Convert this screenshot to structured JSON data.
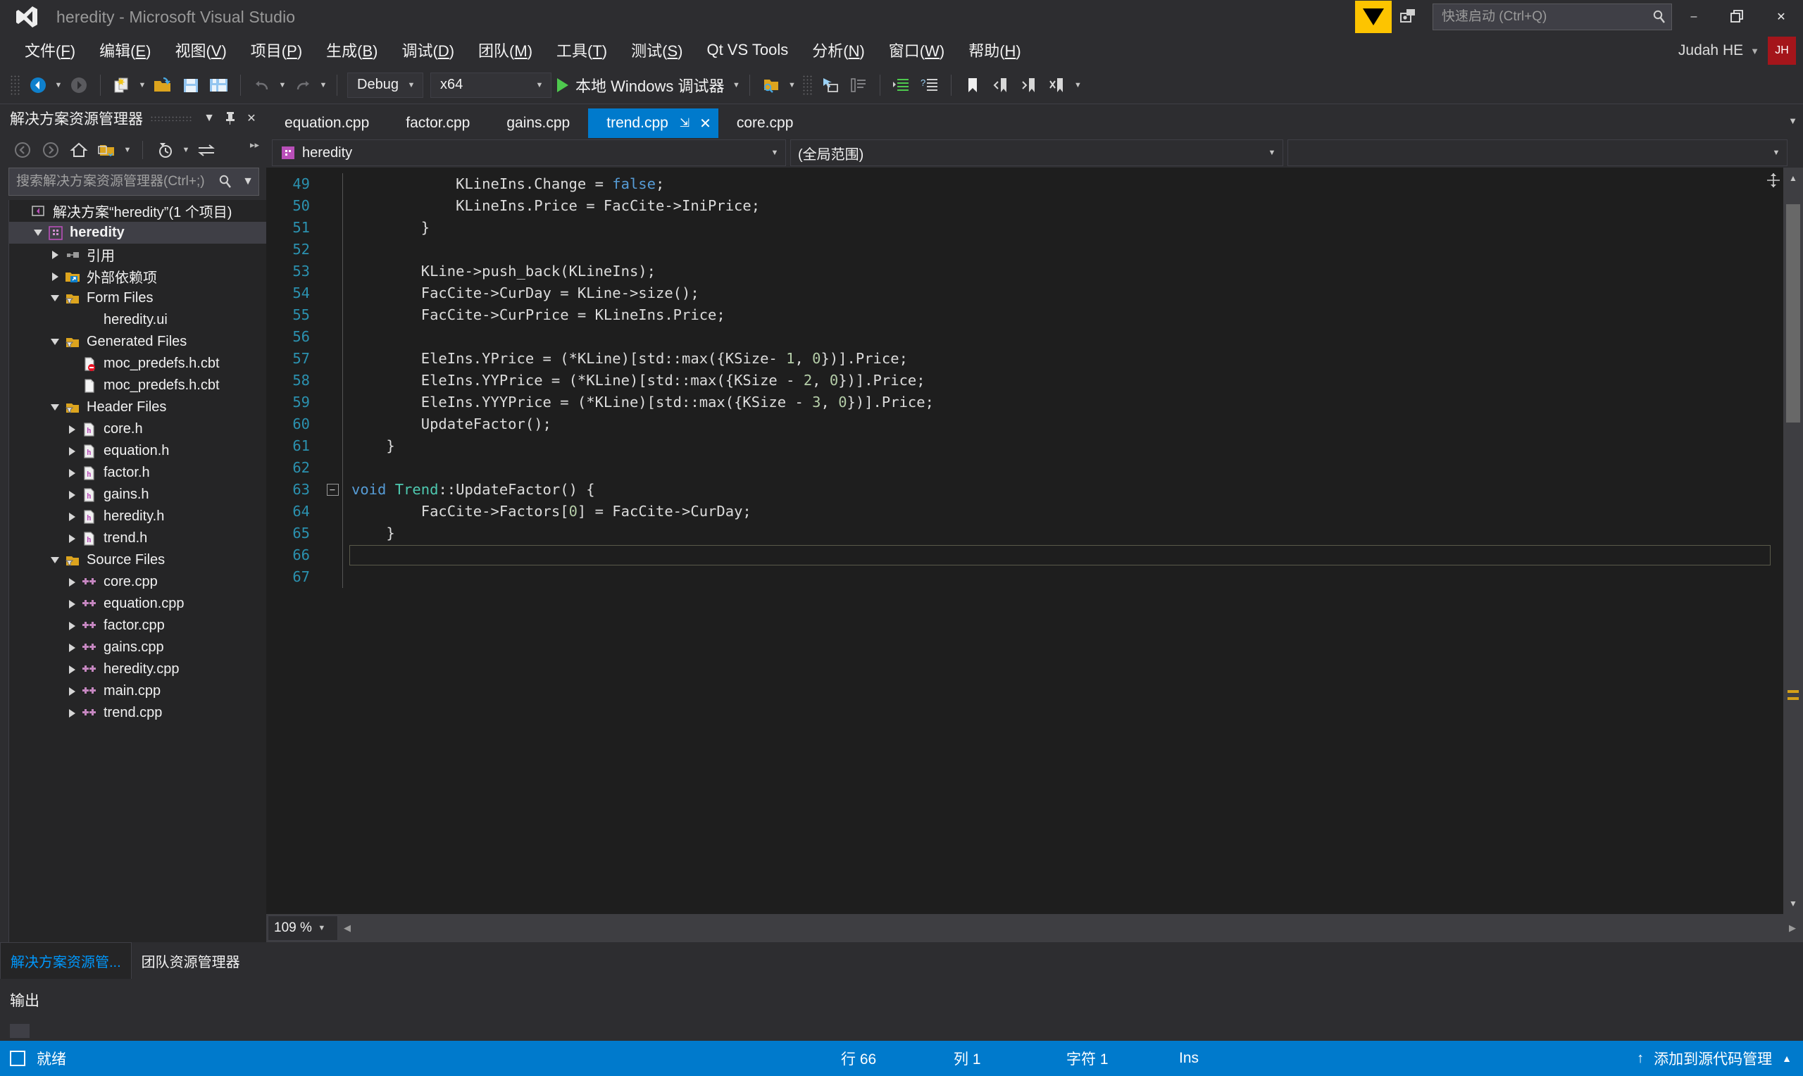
{
  "window": {
    "title": "heredity - Microsoft Visual Studio",
    "minimize": "–",
    "restore": "❐",
    "close": "✕"
  },
  "titlebar": {
    "quick_launch_placeholder": "快速启动 (Ctrl+Q)",
    "quick_launch_value": "",
    "user_name": "Judah HE",
    "user_initials": "JH",
    "accent_color": "#007acc",
    "feedback_color": "#fdc400",
    "avatar_color": "#a4151b"
  },
  "menubar": {
    "items": [
      {
        "label": "文件(F)",
        "key": "F"
      },
      {
        "label": "编辑(E)",
        "key": "E"
      },
      {
        "label": "视图(V)",
        "key": "V"
      },
      {
        "label": "项目(P)",
        "key": "P"
      },
      {
        "label": "生成(B)",
        "key": "B"
      },
      {
        "label": "调试(D)",
        "key": "D"
      },
      {
        "label": "团队(M)",
        "key": "M"
      },
      {
        "label": "工具(T)",
        "key": "T"
      },
      {
        "label": "测试(S)",
        "key": "S"
      },
      {
        "label": "Qt VS Tools",
        "key": ""
      },
      {
        "label": "分析(N)",
        "key": "N"
      },
      {
        "label": "窗口(W)",
        "key": "W"
      },
      {
        "label": "帮助(H)",
        "key": "H"
      }
    ]
  },
  "toolbar": {
    "configuration": "Debug",
    "platform": "x64",
    "run_label": "本地 Windows 调试器",
    "icons": [
      "navigate-back-icon",
      "navigate-forward-icon",
      "new-item-icon",
      "open-file-icon",
      "save-icon",
      "save-all-icon",
      "undo-icon",
      "redo-icon"
    ]
  },
  "solution_explorer": {
    "title": "解决方案资源管理器",
    "search_placeholder": "搜索解决方案资源管理器(Ctrl+;)",
    "search_value": "",
    "tree": [
      {
        "label": "解决方案“heredity”(1 个项目)",
        "indent": 0,
        "twisty": "none",
        "icon": "solution-icon",
        "bold": false,
        "selected": false
      },
      {
        "label": "heredity",
        "indent": 1,
        "twisty": "down",
        "icon": "project-icon",
        "bold": true,
        "selected": true
      },
      {
        "label": "引用",
        "indent": 2,
        "twisty": "right",
        "icon": "references-icon",
        "bold": false,
        "selected": false
      },
      {
        "label": "外部依赖项",
        "indent": 2,
        "twisty": "right",
        "icon": "extdeps-icon",
        "bold": false,
        "selected": false
      },
      {
        "label": "Form Files",
        "indent": 2,
        "twisty": "down",
        "icon": "filter-folder-icon",
        "bold": false,
        "selected": false
      },
      {
        "label": "heredity.ui",
        "indent": 3,
        "twisty": "none",
        "icon": "none",
        "bold": false,
        "selected": false
      },
      {
        "label": "Generated Files",
        "indent": 2,
        "twisty": "down",
        "icon": "filter-folder-icon",
        "bold": false,
        "selected": false
      },
      {
        "label": "moc_predefs.h.cbt",
        "indent": 3,
        "twisty": "none",
        "icon": "file-error-icon",
        "bold": false,
        "selected": false
      },
      {
        "label": "moc_predefs.h.cbt",
        "indent": 3,
        "twisty": "none",
        "icon": "file-icon",
        "bold": false,
        "selected": false
      },
      {
        "label": "Header Files",
        "indent": 2,
        "twisty": "down",
        "icon": "filter-folder-icon",
        "bold": false,
        "selected": false
      },
      {
        "label": "core.h",
        "indent": 3,
        "twisty": "right",
        "icon": "header-icon",
        "bold": false,
        "selected": false
      },
      {
        "label": "equation.h",
        "indent": 3,
        "twisty": "right",
        "icon": "header-icon",
        "bold": false,
        "selected": false
      },
      {
        "label": "factor.h",
        "indent": 3,
        "twisty": "right",
        "icon": "header-icon",
        "bold": false,
        "selected": false
      },
      {
        "label": "gains.h",
        "indent": 3,
        "twisty": "right",
        "icon": "header-icon",
        "bold": false,
        "selected": false
      },
      {
        "label": "heredity.h",
        "indent": 3,
        "twisty": "right",
        "icon": "header-icon",
        "bold": false,
        "selected": false
      },
      {
        "label": "trend.h",
        "indent": 3,
        "twisty": "right",
        "icon": "header-icon",
        "bold": false,
        "selected": false
      },
      {
        "label": "Source Files",
        "indent": 2,
        "twisty": "down",
        "icon": "filter-folder-icon",
        "bold": false,
        "selected": false
      },
      {
        "label": "core.cpp",
        "indent": 3,
        "twisty": "right",
        "icon": "cpp-icon",
        "bold": false,
        "selected": false
      },
      {
        "label": "equation.cpp",
        "indent": 3,
        "twisty": "right",
        "icon": "cpp-icon",
        "bold": false,
        "selected": false
      },
      {
        "label": "factor.cpp",
        "indent": 3,
        "twisty": "right",
        "icon": "cpp-icon",
        "bold": false,
        "selected": false
      },
      {
        "label": "gains.cpp",
        "indent": 3,
        "twisty": "right",
        "icon": "cpp-icon",
        "bold": false,
        "selected": false
      },
      {
        "label": "heredity.cpp",
        "indent": 3,
        "twisty": "right",
        "icon": "cpp-icon",
        "bold": false,
        "selected": false
      },
      {
        "label": "main.cpp",
        "indent": 3,
        "twisty": "right",
        "icon": "cpp-icon",
        "bold": false,
        "selected": false
      },
      {
        "label": "trend.cpp",
        "indent": 3,
        "twisty": "right",
        "icon": "cpp-icon",
        "bold": false,
        "selected": false
      }
    ]
  },
  "editor": {
    "tabs": [
      {
        "label": "equation.cpp",
        "active": false
      },
      {
        "label": "factor.cpp",
        "active": false
      },
      {
        "label": "gains.cpp",
        "active": false
      },
      {
        "label": "trend.cpp",
        "active": true
      },
      {
        "label": "core.cpp",
        "active": false
      }
    ],
    "tab_pin": "⇲",
    "tab_close": "✕",
    "nav_project": "heredity",
    "nav_scope": "(全局范围)",
    "nav_member": "",
    "zoom": "109 %",
    "lines": [
      {
        "n": 49,
        "fold": "",
        "indent": 3,
        "tokens": [
          {
            "t": "KLineIns.Change = ",
            "c": ""
          },
          {
            "t": "false",
            "c": "kw"
          },
          {
            "t": ";",
            "c": ""
          }
        ]
      },
      {
        "n": 50,
        "fold": "",
        "indent": 3,
        "tokens": [
          {
            "t": "KLineIns.Price = FacCite->IniPrice;",
            "c": ""
          }
        ]
      },
      {
        "n": 51,
        "fold": "",
        "indent": 2,
        "tokens": [
          {
            "t": "}",
            "c": ""
          }
        ]
      },
      {
        "n": 52,
        "fold": "",
        "indent": 0,
        "tokens": [
          {
            "t": "",
            "c": ""
          }
        ]
      },
      {
        "n": 53,
        "fold": "",
        "indent": 2,
        "tokens": [
          {
            "t": "KLine->push_back(KLineIns);",
            "c": ""
          }
        ]
      },
      {
        "n": 54,
        "fold": "",
        "indent": 2,
        "tokens": [
          {
            "t": "FacCite->CurDay = KLine->size();",
            "c": ""
          }
        ]
      },
      {
        "n": 55,
        "fold": "",
        "indent": 2,
        "tokens": [
          {
            "t": "FacCite->CurPrice = KLineIns.Price;",
            "c": ""
          }
        ]
      },
      {
        "n": 56,
        "fold": "",
        "indent": 0,
        "tokens": [
          {
            "t": "",
            "c": ""
          }
        ]
      },
      {
        "n": 57,
        "fold": "",
        "indent": 2,
        "tokens": [
          {
            "t": "EleIns.YPrice = (*KLine)[std::max({KSize- ",
            "c": ""
          },
          {
            "t": "1",
            "c": "num"
          },
          {
            "t": ", ",
            "c": ""
          },
          {
            "t": "0",
            "c": "num"
          },
          {
            "t": "})].Price;",
            "c": ""
          }
        ]
      },
      {
        "n": 58,
        "fold": "",
        "indent": 2,
        "tokens": [
          {
            "t": "EleIns.YYPrice = (*KLine)[std::max({KSize - ",
            "c": ""
          },
          {
            "t": "2",
            "c": "num"
          },
          {
            "t": ", ",
            "c": ""
          },
          {
            "t": "0",
            "c": "num"
          },
          {
            "t": "})].Price;",
            "c": ""
          }
        ]
      },
      {
        "n": 59,
        "fold": "",
        "indent": 2,
        "tokens": [
          {
            "t": "EleIns.YYYPrice = (*KLine)[std::max({KSize - ",
            "c": ""
          },
          {
            "t": "3",
            "c": "num"
          },
          {
            "t": ", ",
            "c": ""
          },
          {
            "t": "0",
            "c": "num"
          },
          {
            "t": "})].Price;",
            "c": ""
          }
        ]
      },
      {
        "n": 60,
        "fold": "",
        "indent": 2,
        "tokens": [
          {
            "t": "UpdateFactor();",
            "c": ""
          }
        ]
      },
      {
        "n": 61,
        "fold": "",
        "indent": 1,
        "tokens": [
          {
            "t": "}",
            "c": ""
          }
        ]
      },
      {
        "n": 62,
        "fold": "",
        "indent": 0,
        "tokens": [
          {
            "t": "",
            "c": ""
          }
        ]
      },
      {
        "n": 63,
        "fold": "minus",
        "indent": 0,
        "tokens": [
          {
            "t": "void ",
            "c": "kw"
          },
          {
            "t": "Trend",
            "c": "ty"
          },
          {
            "t": "::UpdateFactor() {",
            "c": ""
          }
        ]
      },
      {
        "n": 64,
        "fold": "",
        "indent": 2,
        "tokens": [
          {
            "t": "FacCite->Factors[",
            "c": ""
          },
          {
            "t": "0",
            "c": "num"
          },
          {
            "t": "] = FacCite->CurDay;",
            "c": ""
          }
        ]
      },
      {
        "n": 65,
        "fold": "",
        "indent": 1,
        "tokens": [
          {
            "t": "}",
            "c": ""
          }
        ]
      },
      {
        "n": 66,
        "fold": "",
        "indent": 0,
        "tokens": [
          {
            "t": "",
            "c": ""
          }
        ],
        "caret": true
      },
      {
        "n": 67,
        "fold": "",
        "indent": 0,
        "tokens": [
          {
            "t": "",
            "c": ""
          }
        ]
      }
    ]
  },
  "dock_tabs": [
    {
      "label": "解决方案资源管...",
      "selected": true
    },
    {
      "label": "团队资源管理器",
      "selected": false
    }
  ],
  "output_panel": {
    "title": "输出"
  },
  "statusbar": {
    "status": "就绪",
    "line_label": "行 66",
    "col_label": "列 1",
    "char_label": "字符 1",
    "insert_mode": "Ins",
    "source_control": "添加到源代码管理",
    "up_arrow": "↑",
    "caret": "▲",
    "background": "#007acc"
  }
}
